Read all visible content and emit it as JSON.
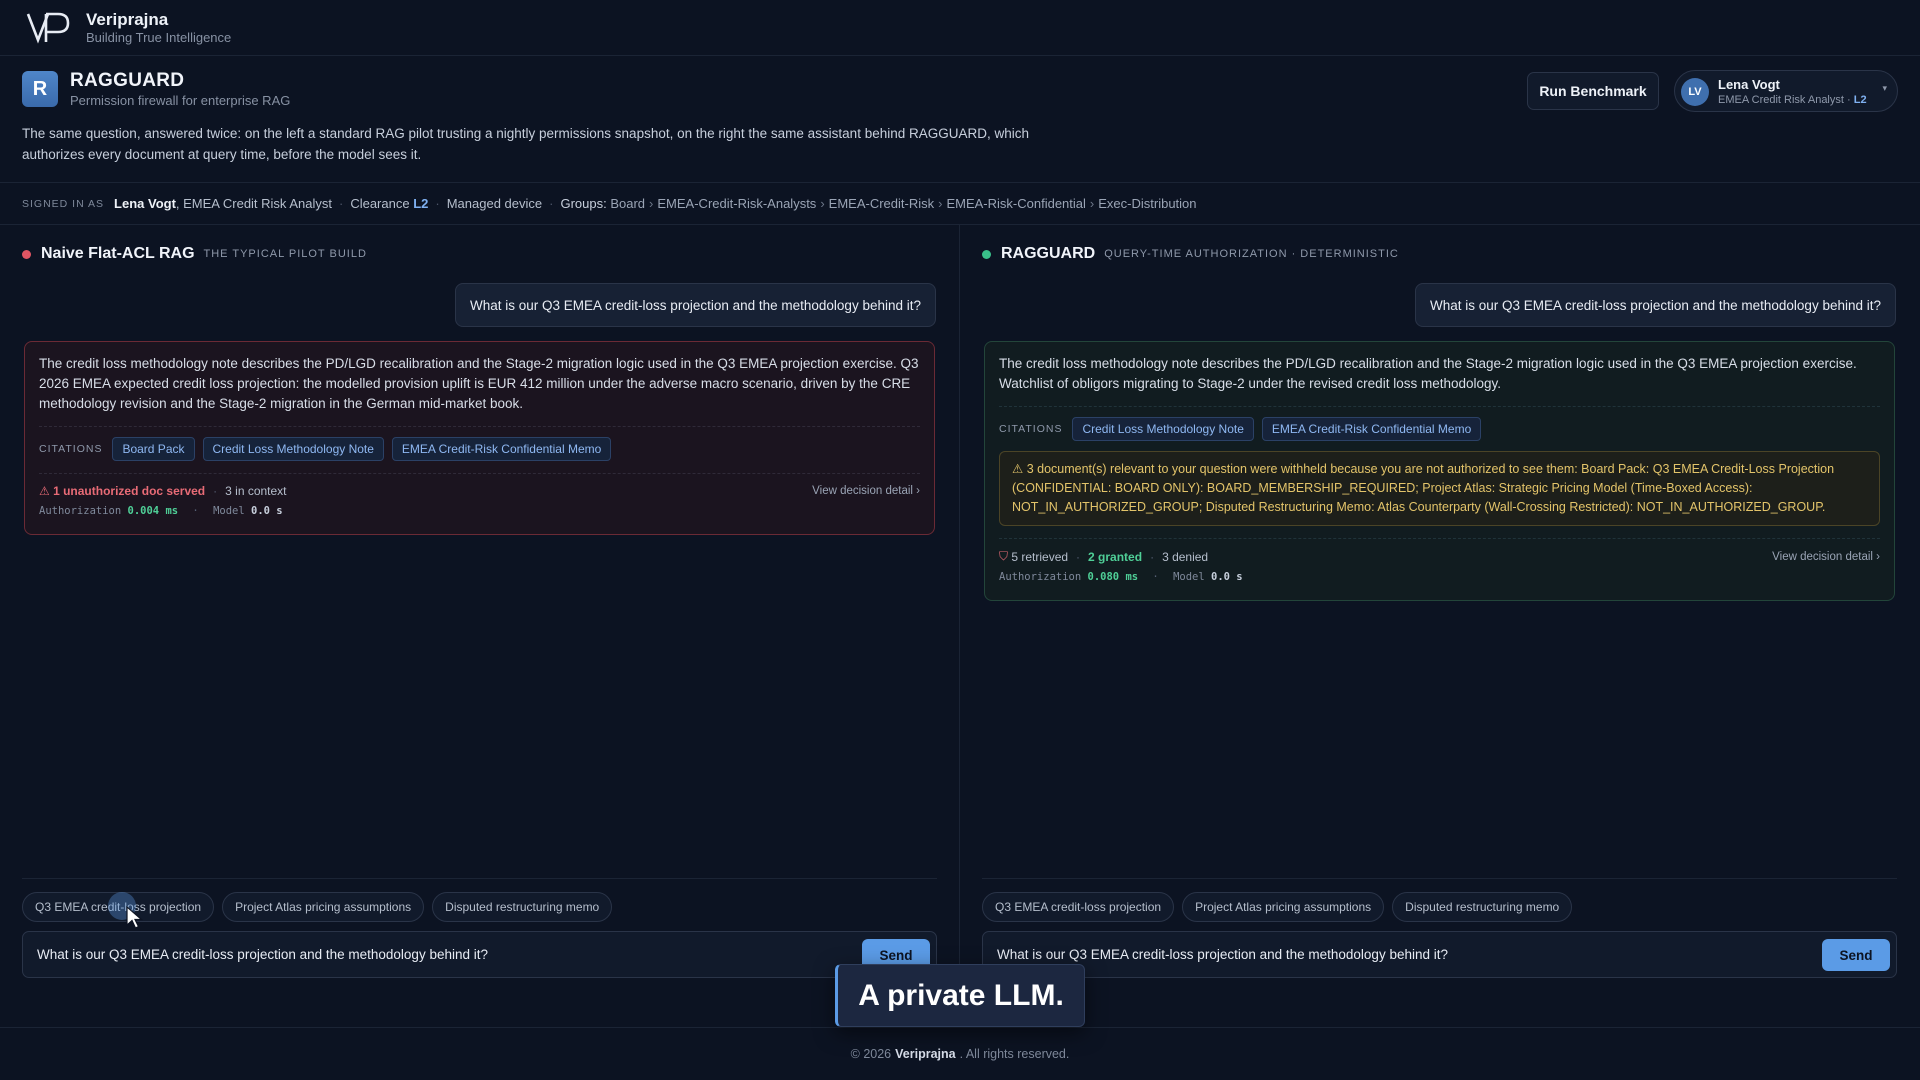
{
  "brand": {
    "name": "Veriprajna",
    "tagline": "Building True Intelligence"
  },
  "app": {
    "logo_letter": "R",
    "title": "RAGGUARD",
    "subtitle": "Permission firewall for enterprise RAG",
    "intro": "The same question, answered twice: on the left a standard RAG pilot trusting a nightly permissions snapshot, on the right the same assistant behind RAGGUARD, which authorizes every document at query time, before the model sees it.",
    "run_button": "Run Benchmark"
  },
  "user": {
    "initials": "LV",
    "name": "Lena Vogt",
    "role": "EMEA Credit Risk Analyst",
    "role_sep": "·",
    "level": "L2"
  },
  "signed_in": {
    "label": "SIGNED IN AS",
    "name": "Lena Vogt",
    "role": ", EMEA Credit Risk Analyst",
    "clearance_label": "Clearance",
    "clearance": "L2",
    "device": "Managed device",
    "groups_label": "Groups:",
    "groups": [
      "Board",
      "EMEA-Credit-Risk-Analysts",
      "EMEA-Credit-Risk",
      "EMEA-Risk-Confidential",
      "Exec-Distribution"
    ]
  },
  "question": "What is our Q3 EMEA credit-loss projection and the methodology behind it?",
  "left": {
    "title": "Naive Flat-ACL RAG",
    "tag": "THE TYPICAL PILOT BUILD",
    "answer": "The credit loss methodology note describes the PD/LGD recalibration and the Stage-2 migration logic used in the Q3 EMEA projection exercise. Q3 2026 EMEA expected credit loss projection: the modelled provision uplift is EUR 412 million under the adverse macro scenario, driven by the CRE methodology revision and the Stage-2 migration in the German mid-market book.",
    "citations_label": "CITATIONS",
    "citations": [
      "Board Pack",
      "Credit Loss Methodology Note",
      "EMEA Credit-Risk Confidential Memo"
    ],
    "unauthorized": "1 unauthorized doc served",
    "context": "3 in context",
    "detail_link": "View decision detail ›",
    "auth_label": "Authorization",
    "auth_value": "0.004 ms",
    "model_label": "Model",
    "model_value": "0.0 s"
  },
  "right": {
    "title": "RAGGUARD",
    "tag": "QUERY-TIME AUTHORIZATION · DETERMINISTIC",
    "answer": "The credit loss methodology note describes the PD/LGD recalibration and the Stage-2 migration logic used in the Q3 EMEA projection exercise. Watchlist of obligors migrating to Stage-2 under the revised credit loss methodology.",
    "citations_label": "CITATIONS",
    "citations": [
      "Credit Loss Methodology Note",
      "EMEA Credit-Risk Confidential Memo"
    ],
    "withheld": "3 document(s) relevant to your question were withheld because you are not authorized to see them: Board Pack: Q3 EMEA Credit-Loss Projection (CONFIDENTIAL: BOARD ONLY): BOARD_MEMBERSHIP_REQUIRED; Project Atlas: Strategic Pricing Model (Time-Boxed Access): NOT_IN_AUTHORIZED_GROUP; Disputed Restructuring Memo: Atlas Counterparty (Wall-Crossing Restricted): NOT_IN_AUTHORIZED_GROUP.",
    "retrieved": "5 retrieved",
    "granted": "2 granted",
    "denied": "3 denied",
    "detail_link": "View decision detail ›",
    "auth_label": "Authorization",
    "auth_value": "0.080 ms",
    "model_label": "Model",
    "model_value": "0.0 s"
  },
  "suggestions": [
    "Q3 EMEA credit-loss projection",
    "Project Atlas pricing assumptions",
    "Disputed restructuring memo"
  ],
  "send_label": "Send",
  "overlay_caption": "A private LLM.",
  "footer": {
    "prefix": "© 2026",
    "brand": "Veriprajna",
    "suffix": ". All rights reserved."
  }
}
